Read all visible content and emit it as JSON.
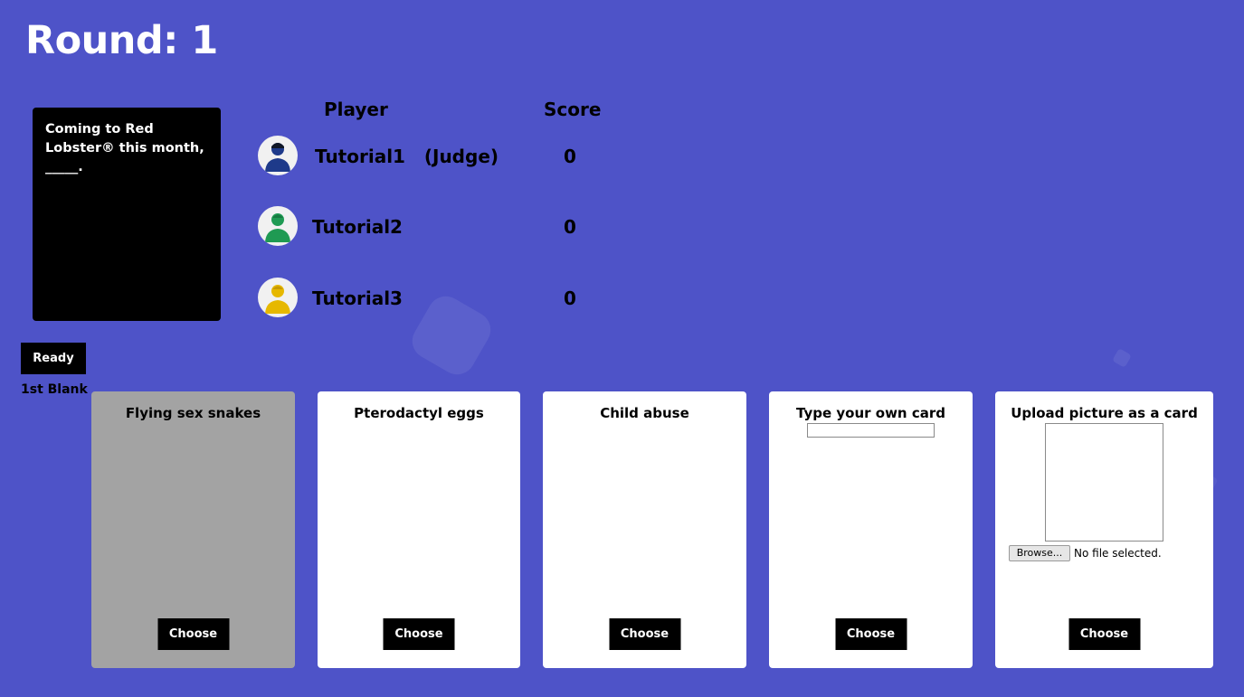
{
  "round": {
    "title": "Round: 1"
  },
  "black_card": {
    "text": "Coming to Red Lobster® this month, _____."
  },
  "scoreboard": {
    "player_header": "Player",
    "score_header": "Score",
    "players": [
      {
        "name": "Tutorial1   (Judge)",
        "score": "0",
        "avatar_icon": "person-avatar-icon",
        "avatar_color": "#1e3a8a"
      },
      {
        "name": "Tutorial2",
        "score": "0",
        "avatar_icon": "person-avatar-icon",
        "avatar_color": "#1f9a53"
      },
      {
        "name": "Tutorial3",
        "score": "0",
        "avatar_icon": "person-avatar-icon",
        "avatar_color": "#e6b800"
      }
    ]
  },
  "controls": {
    "ready_label": "Ready",
    "blank_label": "1st Blank"
  },
  "hand": {
    "cards": [
      {
        "text": "Flying sex snakes",
        "choose_label": "Choose",
        "selected": true
      },
      {
        "text": "Pterodactyl eggs",
        "choose_label": "Choose",
        "selected": false
      },
      {
        "text": "Child abuse",
        "choose_label": "Choose",
        "selected": false
      },
      {
        "text": "Type your own card",
        "choose_label": "Choose",
        "input_value": ""
      },
      {
        "text": "Upload picture as a card",
        "choose_label": "Choose",
        "browse_label": "Browse...",
        "file_status": "No file selected."
      }
    ]
  },
  "colors": {
    "background": "#4e53c8",
    "card_selected": "#a3a3a3",
    "button": "#000000"
  }
}
